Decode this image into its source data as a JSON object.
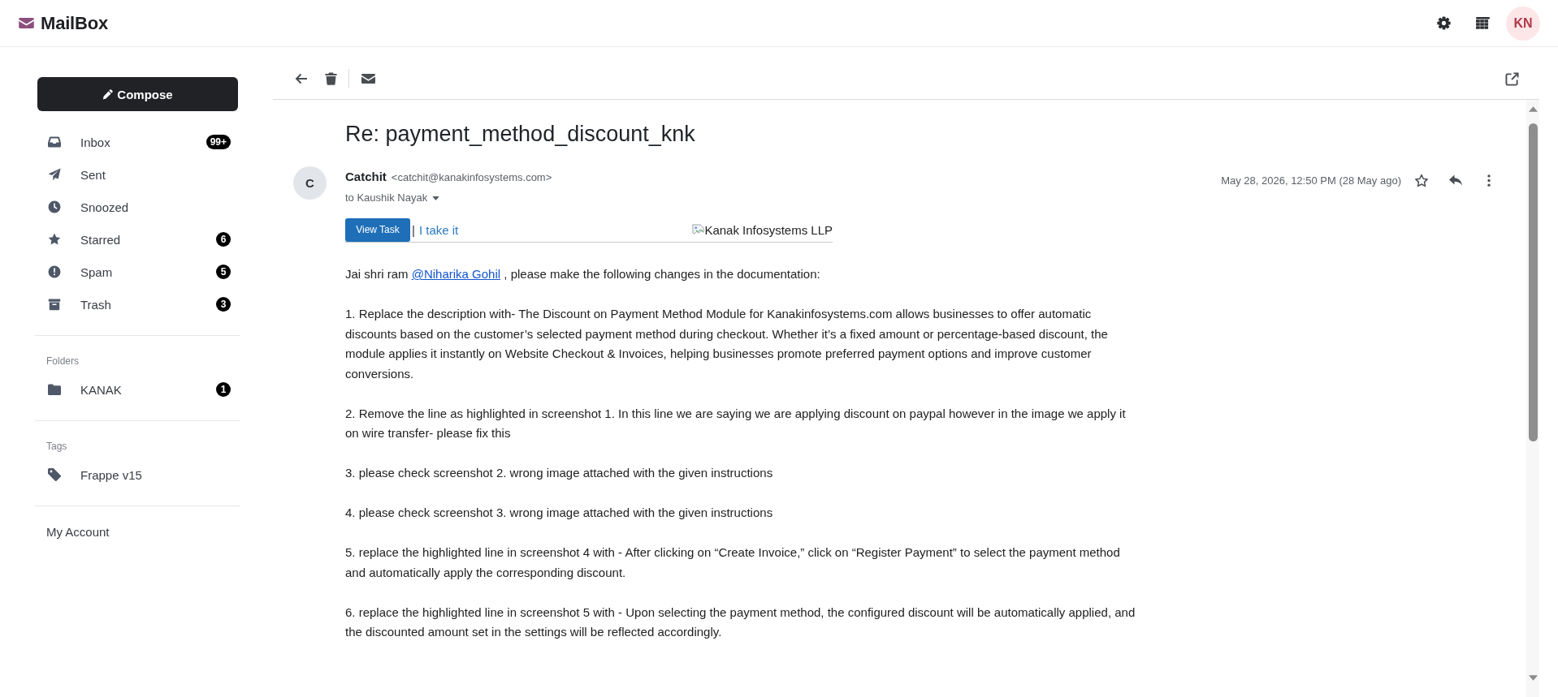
{
  "app_bar": {
    "title": "MailBox",
    "avatar_initials": "KN"
  },
  "sidebar": {
    "compose_label": "Compose",
    "mailboxes": [
      {
        "label": "Inbox",
        "count": "99+"
      },
      {
        "label": "Sent"
      },
      {
        "label": "Snoozed"
      },
      {
        "label": "Starred",
        "count": "6"
      },
      {
        "label": "Spam",
        "count": "5"
      },
      {
        "label": "Trash",
        "count": "3"
      }
    ],
    "folders": {
      "heading": "Folders",
      "items": [
        {
          "label": "KANAK",
          "count": "1"
        }
      ]
    },
    "tags": {
      "heading": "Tags",
      "items": [
        {
          "label": "Frappe v15"
        }
      ]
    },
    "account_link": "My Account"
  },
  "message": {
    "subject": "Re: payment_method_discount_knk",
    "sender": {
      "initial": "C",
      "name": "Catchit",
      "email": "<catchit@kanakinfosystems.com>"
    },
    "recipient": "to Kaushik Nayak",
    "date": "May 28, 2026, 12:50 PM (28 May ago)",
    "starred": false,
    "actions": {
      "button": "View Task",
      "separator": "|",
      "link": "I take it",
      "image_alt": "Kanak Infosystems LLP"
    },
    "greeting": {
      "lead": "Jai shri ram",
      "mention": "@Niharika Gohil",
      "rest": ", please make the following changes in the documentation:"
    },
    "paragraphs": [
      "1. Replace the description with- The Discount on Payment Method Module for Kanakinfosystems.com allows businesses to offer automatic discounts based on the customer’s selected payment method during checkout. Whether it’s a fixed amount or percentage-based discount, the module applies it instantly on Website Checkout & Invoices, helping businesses promote preferred payment options and improve customer conversions.",
      "2. Remove the line as highlighted in screenshot 1. In this line we are saying we are applying discount on paypal however in the image we apply it on wire transfer- please fix this",
      "3. please check screenshot 2. wrong image attached with the given instructions",
      "4. please check screenshot 3. wrong image attached with the given instructions",
      "5. replace the highlighted line in screenshot 4 with - After clicking on “Create Invoice,” click on “Register Payment” to select the payment method and automatically apply the corresponding discount.",
      "6. replace the highlighted line in screenshot 5 with - Upon selecting the payment method, the configured discount will be automatically applied, and the discounted amount set in the settings will be reflected accordingly."
    ]
  }
}
